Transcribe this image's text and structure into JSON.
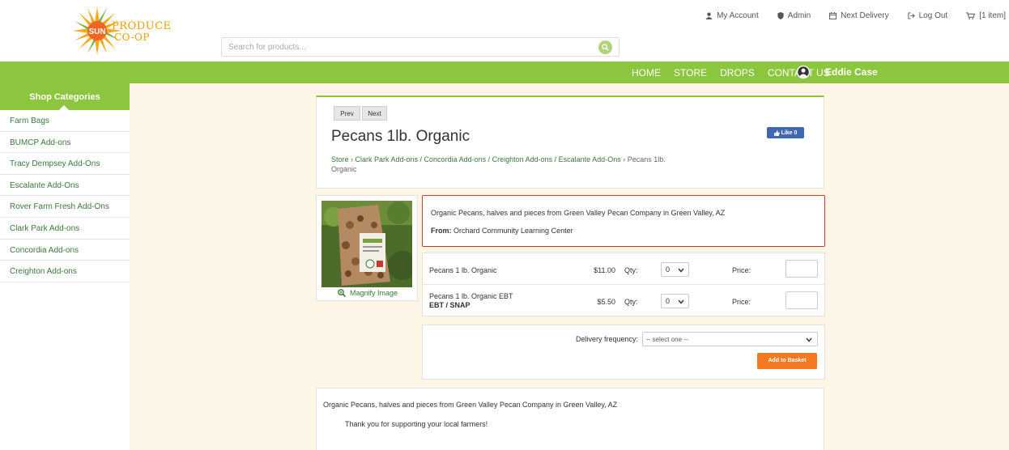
{
  "brand": {
    "logo_word1": "SUN",
    "logo_word2": "PRODUCE",
    "logo_word3": "CO-OP",
    "colors": {
      "green": "#8cc63f",
      "orange": "#f47920",
      "sun": "#f7c531"
    }
  },
  "search": {
    "placeholder": "Search for products...",
    "icon": "search-icon"
  },
  "top_links": [
    {
      "icon": "user-icon",
      "label": "My Account"
    },
    {
      "icon": "shield-icon",
      "label": "Admin"
    },
    {
      "icon": "calendar-icon",
      "label": "Next Delivery"
    },
    {
      "icon": "logout-icon",
      "label": "Log Out"
    },
    {
      "icon": "cart-icon",
      "label": "[1 item]"
    }
  ],
  "nav": [
    "HOME",
    "STORE",
    "DROPS",
    "CONTACT US"
  ],
  "user": {
    "name": "Eddie Case",
    "icon": "user-avatar-icon"
  },
  "sidebar": {
    "heading": "Shop Categories",
    "items": [
      "Farm Bags",
      "BUMCP Add-ons",
      "Tracy Dempsey Add-Ons",
      "Escalante Add-Ons",
      "Rover Farm Fresh Add-Ons",
      "Clark Park Add-ons",
      "Concordia Add-ons",
      "Creighton Add-ons"
    ]
  },
  "product": {
    "prev_label": "Prev",
    "next_label": "Next",
    "title": "Pecans 1lb. Organic",
    "like_label": "Like 0",
    "breadcrumb": {
      "store": "Store",
      "sep": " › ",
      "category": "Clark Park Add-ons / Concordia Add-ons / Creighton Add-ons / Escalante Add-Ons",
      "current": "Pecans 1lb. Organic"
    },
    "magnify_label": "Magnify Image",
    "description": "Organic Pecans, halves and pieces from Green Valley Pecan Company in Green Valley, AZ",
    "from_label": "From:",
    "from_value": "Orchard Community Learning Center"
  },
  "price_rows": [
    {
      "name": "Pecans 1 lb. Organic",
      "sub": "",
      "price": "$11.00",
      "qty_label": "Qty:",
      "qty": "0",
      "price_label": "Price:"
    },
    {
      "name": "Pecans 1 lb. Organic EBT",
      "sub": "EBT / SNAP",
      "price": "$5.50",
      "qty_label": "Qty:",
      "qty": "0",
      "price_label": "Price:"
    }
  ],
  "delivery": {
    "label": "Delivery frequency:",
    "selected": "-- select one --",
    "add_button": "Add to Basket"
  },
  "long_description": {
    "line1": "Organic Pecans, halves and pieces from Green Valley Pecan Company in Green Valley, AZ",
    "line2": "Thank you for supporting your local farmers!"
  }
}
